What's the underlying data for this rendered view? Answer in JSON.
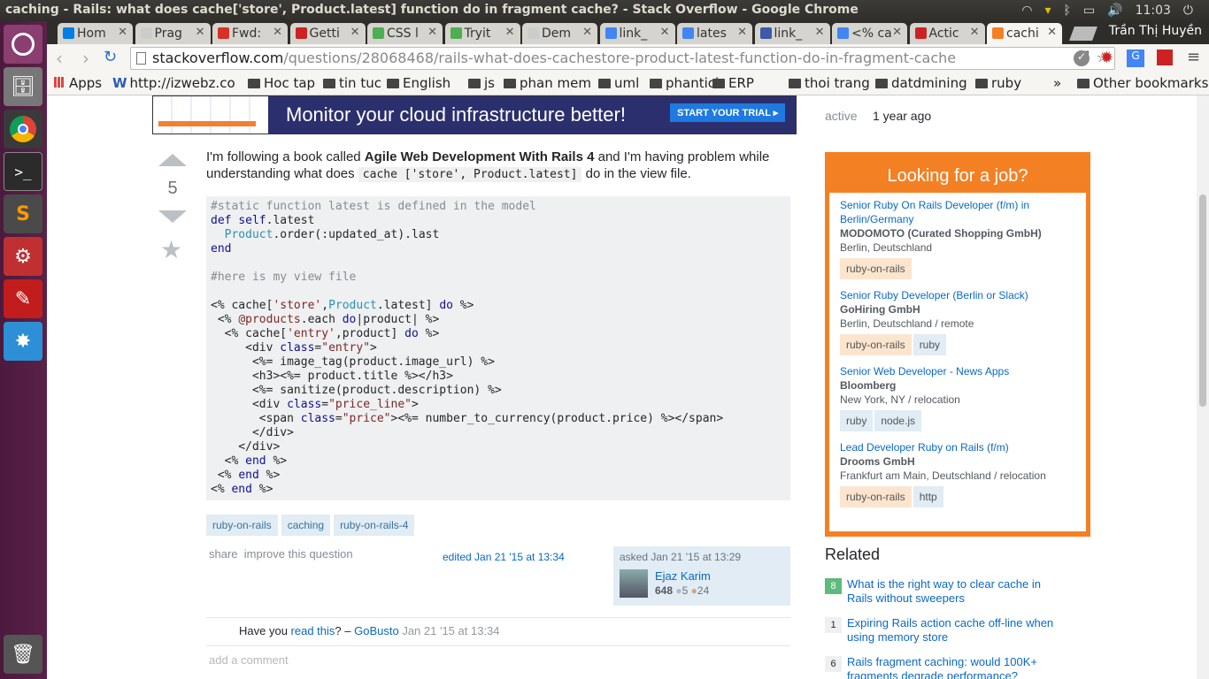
{
  "window_title": "caching - Rails: what does cache['store', Product.latest] function do in fragment cache? - Stack Overflow - Google Chrome",
  "clock": "11:03",
  "tabs": [
    {
      "label": "Hom",
      "icon": "dropbox-icon"
    },
    {
      "label": "Prag",
      "icon": "page-icon"
    },
    {
      "label": "Fwd:",
      "icon": "gmail-icon"
    },
    {
      "label": "Getti",
      "icon": "rails-icon"
    },
    {
      "label": "CSS l",
      "icon": "w3schools-icon"
    },
    {
      "label": "Tryit",
      "icon": "w3schools-icon"
    },
    {
      "label": "Dem",
      "icon": "page-icon"
    },
    {
      "label": "link_",
      "icon": "google-icon"
    },
    {
      "label": "lates",
      "icon": "google-icon"
    },
    {
      "label": "link_",
      "icon": "apidock-icon"
    },
    {
      "label": "<% ca",
      "icon": "google-icon"
    },
    {
      "label": "Actic",
      "icon": "rails-icon"
    },
    {
      "label": "cachi",
      "icon": "stackoverflow-icon"
    }
  ],
  "profile_name": "Trần Thị Huyền",
  "url": {
    "domain": "stackoverflow.com",
    "path": "/questions/28068468/rails-what-does-cachestore-product-latest-function-do-in-fragment-cache"
  },
  "bookmarks": {
    "apps": "Apps",
    "izwebz": "http://izwebz.co",
    "folders": [
      "Hoc tap",
      "tin tuc",
      "English",
      "js",
      "phan mem",
      "uml",
      "phantich",
      "ERP",
      "thoi trang",
      "datdmining",
      "ruby"
    ],
    "more": "»",
    "other": "Other bookmarks"
  },
  "ad": {
    "text": "Monitor your cloud infrastructure better!",
    "cta": "START YOUR TRIAL ▸"
  },
  "question": {
    "votes": "5",
    "intro_1": "I'm following a book called ",
    "book": "Agile Web Development With Rails 4",
    "intro_2": " and I'm having problem while understanding what does ",
    "inline_code": "cache ['store', Product.latest]",
    "intro_3": " do in the view file.",
    "tags": [
      "ruby-on-rails",
      "caching",
      "ruby-on-rails-4"
    ],
    "share": "share",
    "improve": "improve this question",
    "edited": "edited Jan 21 '15 at 13:34",
    "asked": "asked Jan 21 '15 at 13:29",
    "user": {
      "name": "Ejaz Karim",
      "rep": "648",
      "silver": "5",
      "bronze": "24"
    }
  },
  "comment": {
    "prefix": "Have you ",
    "link": "read this",
    "suffix": "? – ",
    "author": "GoBusto",
    "date": "Jan 21 '15 at 13:34"
  },
  "add_comment": "add a comment",
  "sidebar": {
    "active_label": "active",
    "active_value": "1 year ago",
    "jobs_title": "Looking for a job?",
    "jobs": [
      {
        "title": "Senior Ruby On Rails Developer (f/m) in Berlin/Germany",
        "company": "MODOMOTO (Curated Shopping GmbH)",
        "location": "Berlin, Deutschland",
        "tags": [
          "ruby-on-rails"
        ]
      },
      {
        "title": "Senior Ruby Developer (Berlin or Slack)",
        "company": "GoHiring GmbH",
        "location": "Berlin, Deutschland / remote",
        "tags": [
          "ruby-on-rails",
          "ruby"
        ]
      },
      {
        "title": "Senior Web Developer - News Apps",
        "company": "Bloomberg",
        "location": "New York, NY / relocation",
        "tags": [
          "ruby",
          "node.js"
        ]
      },
      {
        "title": "Lead Developer Ruby on Rails (f/m)",
        "company": "Drooms GmbH",
        "location": "Frankfurt am Main, Deutschland / relocation",
        "tags": [
          "ruby-on-rails",
          "http"
        ]
      }
    ],
    "related_title": "Related",
    "related": [
      {
        "score": "8",
        "title": "What is the right way to clear cache in Rails without sweepers"
      },
      {
        "score": "1",
        "title": "Expiring Rails action cache off-line when using memory store"
      },
      {
        "score": "6",
        "title": "Rails fragment caching: would 100K+ fragments degrade performance?"
      }
    ]
  },
  "colors": {
    "accent": "#f48024",
    "link": "#0a69c4",
    "tag_bg": "#e1ecf4",
    "launcher": "#5a2149"
  }
}
